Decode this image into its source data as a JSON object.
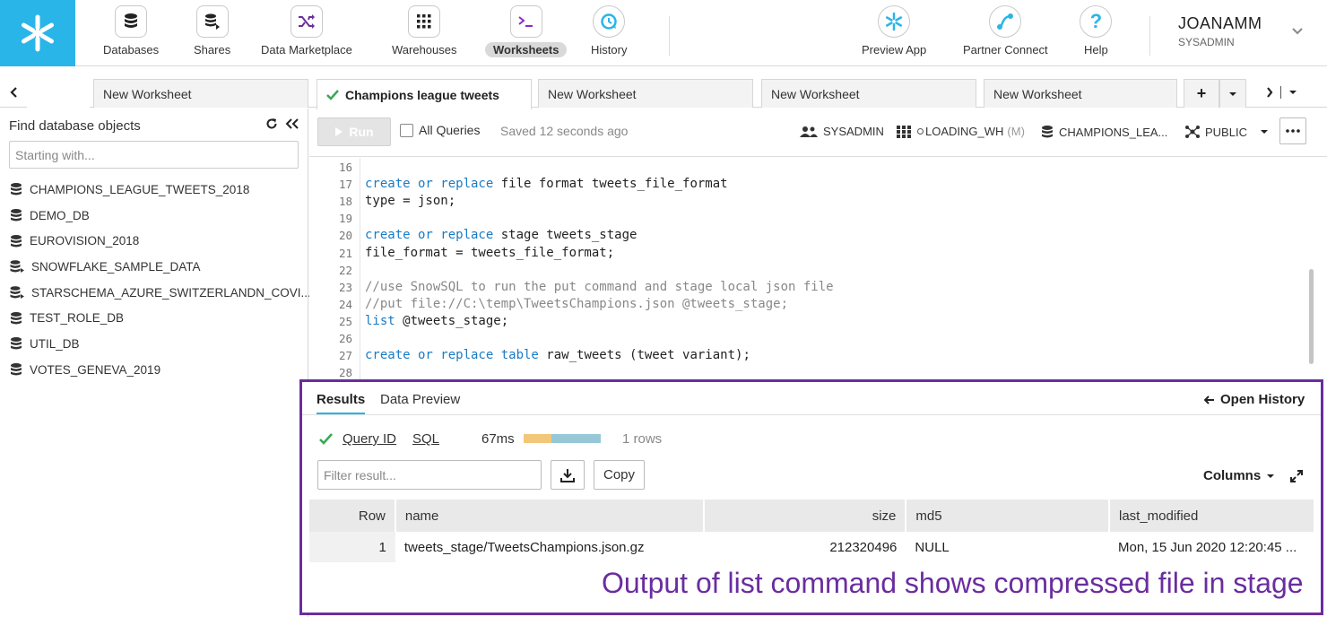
{
  "nav": {
    "items": [
      {
        "label": "Databases",
        "icon": "database-icon"
      },
      {
        "label": "Shares",
        "icon": "share-icon"
      },
      {
        "label": "Data Marketplace",
        "icon": "shuffle-icon"
      },
      {
        "label": "Warehouses",
        "icon": "warehouse-grid-icon"
      },
      {
        "label": "Worksheets",
        "icon": "terminal-icon",
        "active": true
      },
      {
        "label": "History",
        "icon": "history-icon"
      }
    ],
    "right_items": [
      {
        "label": "Preview App",
        "icon": "snowflake-icon"
      },
      {
        "label": "Partner Connect",
        "icon": "connect-icon"
      },
      {
        "label": "Help",
        "icon": "help-icon",
        "glyph": "?"
      }
    ],
    "user": {
      "name": "JOANAMM",
      "role": "SYSADMIN"
    }
  },
  "tabs": [
    {
      "label": "New Worksheet"
    },
    {
      "label": "Champions league tweets",
      "active": true
    },
    {
      "label": "New Worksheet"
    },
    {
      "label": "New Worksheet"
    },
    {
      "label": "New Worksheet"
    }
  ],
  "tabs_add": "+",
  "sidebar": {
    "title": "Find database objects",
    "search_placeholder": "Starting with...",
    "items": [
      {
        "label": "CHAMPIONS_LEAGUE_TWEETS_2018",
        "icon": "database-icon"
      },
      {
        "label": "DEMO_DB",
        "icon": "database-icon"
      },
      {
        "label": "EUROVISION_2018",
        "icon": "database-icon"
      },
      {
        "label": "SNOWFLAKE_SAMPLE_DATA",
        "icon": "shared-database-icon"
      },
      {
        "label": "STARSCHEMA_AZURE_SWITZERLANDN_COVI...",
        "icon": "shared-database-icon"
      },
      {
        "label": "TEST_ROLE_DB",
        "icon": "database-icon"
      },
      {
        "label": "UTIL_DB",
        "icon": "database-icon"
      },
      {
        "label": "VOTES_GENEVA_2019",
        "icon": "database-icon"
      }
    ]
  },
  "toolbar": {
    "run_label": "Run",
    "all_queries_label": "All Queries",
    "saved_text": "Saved 12 seconds ago",
    "role": "SYSADMIN",
    "warehouse": "LOADING_WH",
    "warehouse_size": "(M)",
    "database": "CHAMPIONS_LEA...",
    "schema": "PUBLIC"
  },
  "editor": {
    "lines": [
      {
        "n": "16",
        "parts": []
      },
      {
        "n": "17",
        "parts": [
          {
            "t": "create or replace",
            "c": "kw"
          },
          {
            "t": " file format tweets_file_format",
            "c": ""
          }
        ]
      },
      {
        "n": "18",
        "parts": [
          {
            "t": "type = json;",
            "c": ""
          }
        ]
      },
      {
        "n": "19",
        "parts": []
      },
      {
        "n": "20",
        "parts": [
          {
            "t": "create or replace",
            "c": "kw"
          },
          {
            "t": " stage tweets_stage",
            "c": ""
          }
        ]
      },
      {
        "n": "21",
        "parts": [
          {
            "t": "file_format = tweets_file_format;",
            "c": ""
          }
        ]
      },
      {
        "n": "22",
        "parts": []
      },
      {
        "n": "23",
        "parts": [
          {
            "t": "//use SnowSQL to run the put command and stage local json file",
            "c": "cm"
          }
        ]
      },
      {
        "n": "24",
        "parts": [
          {
            "t": "//put file://C:\\temp\\TweetsChampions.json @tweets_stage;",
            "c": "cm"
          }
        ]
      },
      {
        "n": "25",
        "parts": [
          {
            "t": "list",
            "c": "kw"
          },
          {
            "t": " @tweets_stage;",
            "c": ""
          }
        ]
      },
      {
        "n": "26",
        "parts": []
      },
      {
        "n": "27",
        "parts": [
          {
            "t": "create or replace table",
            "c": "kw"
          },
          {
            "t": " raw_tweets (tweet variant);",
            "c": ""
          }
        ]
      },
      {
        "n": "28",
        "parts": []
      }
    ]
  },
  "results": {
    "tabs": [
      "Results",
      "Data Preview"
    ],
    "open_history": "Open History",
    "query_id": "Query ID",
    "sql_link": "SQL",
    "duration": "67ms",
    "row_count": "1 rows",
    "filter_placeholder": "Filter result...",
    "copy_label": "Copy",
    "columns_label": "Columns",
    "table": {
      "headers": [
        "Row",
        "name",
        "size",
        "md5",
        "last_modified"
      ],
      "rows": [
        [
          "1",
          "tweets_stage/TweetsChampions.json.gz",
          "212320496",
          "NULL",
          "Mon, 15 Jun 2020 12:20:45 ..."
        ]
      ]
    },
    "annotation": "Output of list command shows compressed file in stage"
  },
  "colors": {
    "brand": "#29b5e8",
    "annotation": "#6a2d9f",
    "keyword": "#1a7bc4",
    "success": "#3aa757"
  }
}
